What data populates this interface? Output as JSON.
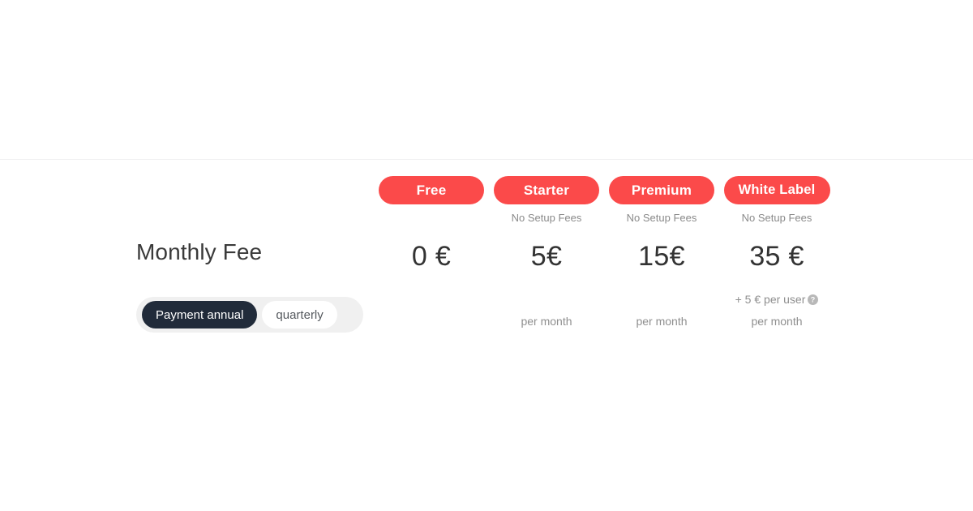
{
  "theme": {
    "badge_color": "#fb4a4a",
    "toggle_active_bg": "#212b3a",
    "toggle_track_bg": "#f0f0f0",
    "muted_text": "#8f8f8f",
    "price_text": "#333333"
  },
  "feature_row": {
    "title": "Monthly Fee"
  },
  "billing_toggle": {
    "active_label": "Payment annual",
    "inactive_label": "quarterly"
  },
  "plans": [
    {
      "name": "Free",
      "setup_note": "",
      "price": "0 €",
      "per_user": "",
      "period": ""
    },
    {
      "name": "Starter",
      "setup_note": "No Setup Fees",
      "price": "5€",
      "per_user": "",
      "period": "per month"
    },
    {
      "name": "Premium",
      "setup_note": "No Setup Fees",
      "price": "15€",
      "per_user": "",
      "period": "per month"
    },
    {
      "name": "White Label",
      "setup_note": "No Setup Fees",
      "price": "35 €",
      "per_user": "+ 5 € per user",
      "period": "per month",
      "help_icon": "help-circle-icon"
    }
  ]
}
